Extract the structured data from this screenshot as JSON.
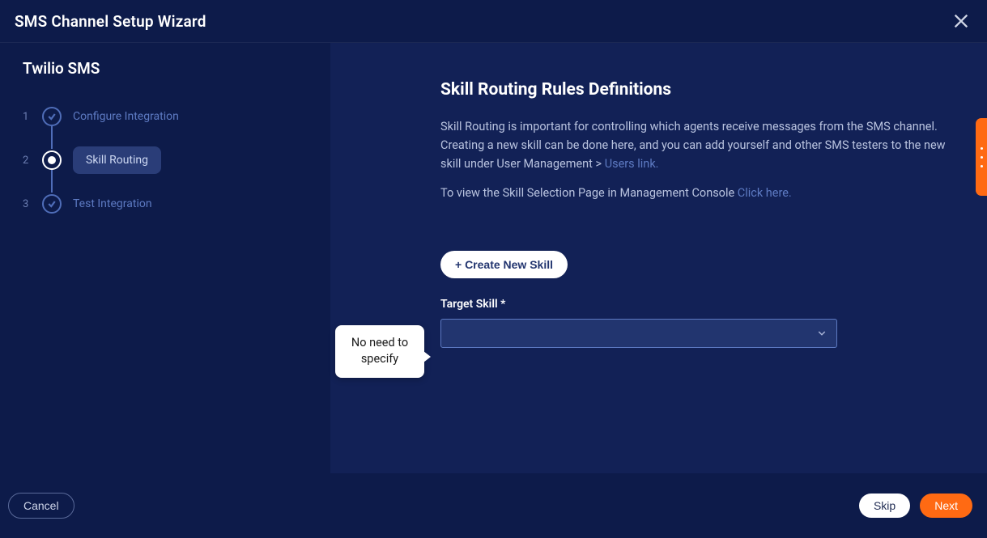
{
  "header": {
    "title": "SMS Channel Setup Wizard"
  },
  "sidebar": {
    "title": "Twilio SMS",
    "steps": [
      {
        "num": "1",
        "label": "Configure Integration"
      },
      {
        "num": "2",
        "label": "Skill Routing"
      },
      {
        "num": "3",
        "label": "Test Integration"
      }
    ]
  },
  "main": {
    "heading": "Skill Routing Rules Definitions",
    "desc1": "Skill Routing is important for controlling which agents receive messages from the SMS channel. Creating a new skill can be done here, and you can add yourself and other SMS testers to the new skill under User Management > ",
    "users_link": "Users link.",
    "desc2": "To view the Skill Selection Page in Management Console ",
    "click_here": "Click here.",
    "create_label": "+ Create New Skill",
    "target_label": "Target Skill *",
    "target_value": ""
  },
  "callout": {
    "text": "No need to specify"
  },
  "footer": {
    "cancel": "Cancel",
    "skip": "Skip",
    "next": "Next"
  }
}
